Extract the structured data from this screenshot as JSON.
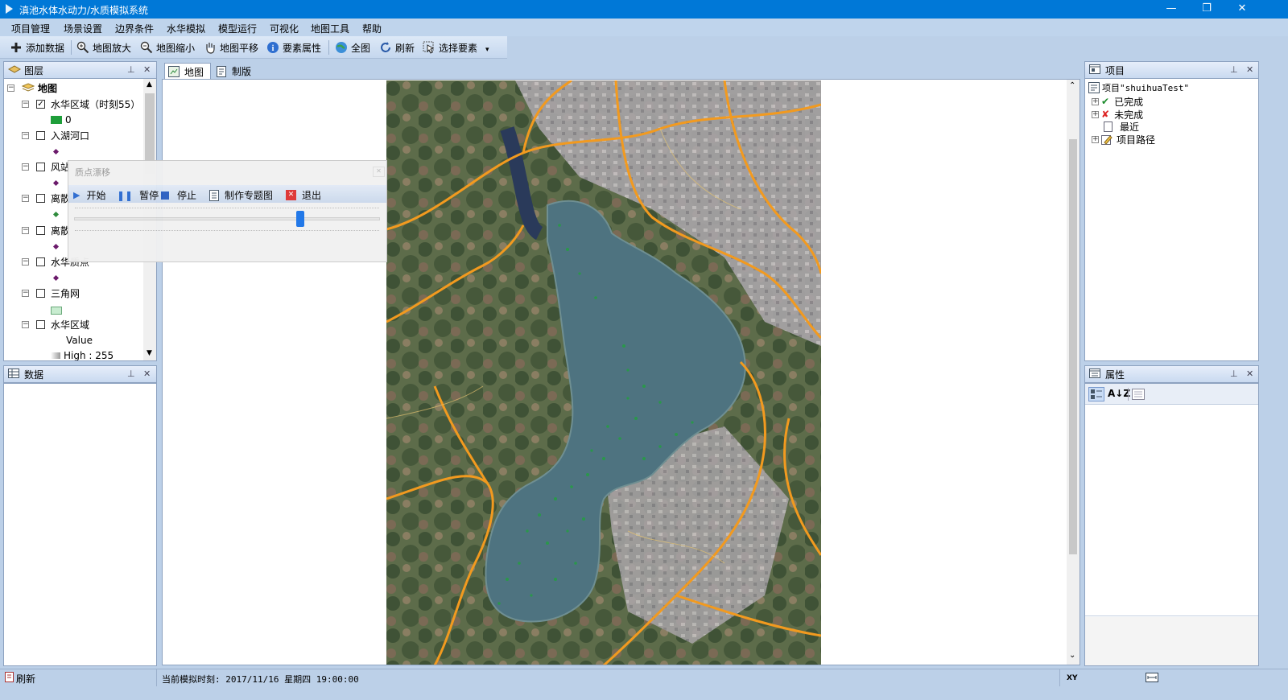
{
  "window": {
    "title": "滇池水体水动力/水质模拟系统",
    "minimize_glyph": "—",
    "restore_glyph": "❐",
    "close_glyph": "✕"
  },
  "menu": [
    "项目管理",
    "场景设置",
    "边界条件",
    "水华模拟",
    "模型运行",
    "可视化",
    "地图工具",
    "帮助"
  ],
  "toolbar": {
    "add_data": "添加数据",
    "zoom_in": "地图放大",
    "zoom_out": "地图缩小",
    "pan": "地图平移",
    "identify": "要素属性",
    "full_extent": "全图",
    "refresh": "刷新",
    "select": "选择要素"
  },
  "layers_panel": {
    "title": "图层",
    "root": "地图",
    "layers": [
      {
        "name": "水华区域（时刻55）",
        "checked": true,
        "legend": "0",
        "legend_color": "#1e9e3a"
      },
      {
        "name": "入湖河口",
        "checked": false,
        "legend_color": "#6b1a6b"
      },
      {
        "name": "风站",
        "checked": false,
        "legend_color": "#6b1a6b"
      },
      {
        "name": "离散",
        "checked": false,
        "legend_color": "#2e8b3c"
      },
      {
        "name": "离散",
        "checked": false,
        "legend_color": "#6b1a6b"
      },
      {
        "name": "水华质点",
        "checked": false,
        "legend_color": "#6b1a6b"
      },
      {
        "name": "三角网",
        "checked": false,
        "legend_color": "#c8ecd0"
      },
      {
        "name": "水华区域",
        "checked": false,
        "value_label": "Value",
        "high_label": "High : 255"
      }
    ]
  },
  "data_panel": {
    "title": "数据"
  },
  "drift_dialog": {
    "title": "质点漂移",
    "start": "开始",
    "pause": "暂停",
    "stop": "停止",
    "make_map": "制作专题图",
    "exit": "退出",
    "slider_value": 0.74
  },
  "map_tabs": [
    "地图",
    "制版"
  ],
  "project_panel": {
    "title": "项目",
    "root": "项目\"shuihuaTest\"",
    "items": [
      "已完成",
      "未完成",
      "最近",
      "项目路径"
    ]
  },
  "properties_panel": {
    "title": "属性"
  },
  "status": {
    "left": "刷新",
    "sim_time": "当前模拟时刻: 2017/11/16 星期四 19:00:00",
    "xy": "XY"
  },
  "colors": {
    "titlebar": "#0078d7",
    "chrome": "#bcd0e8",
    "road": "#f29a1f",
    "lake": "#4e7380",
    "bloom": "#1fa33a"
  }
}
